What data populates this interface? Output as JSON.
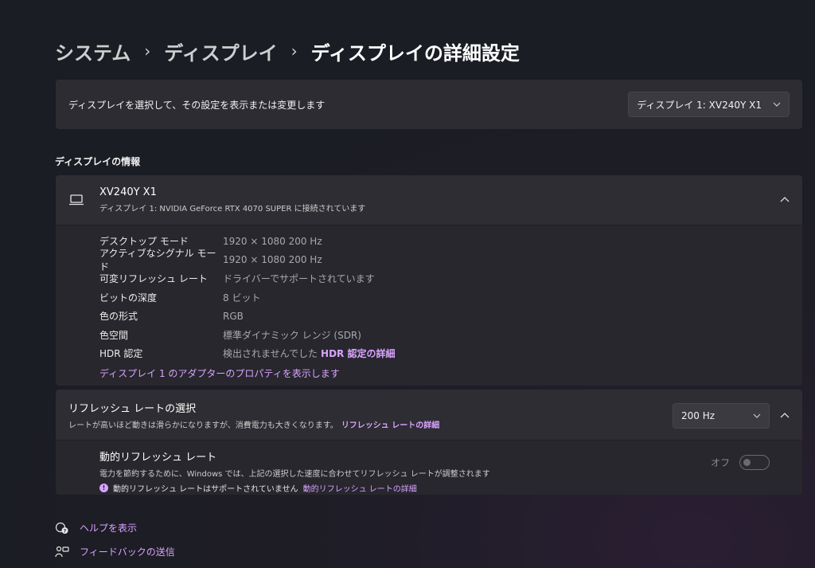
{
  "breadcrumb": {
    "items": [
      "システム",
      "ディスプレイ"
    ],
    "separator": "›",
    "current": "ディスプレイの詳細設定"
  },
  "display_select": {
    "label": "ディスプレイを選択して、その設定を表示または変更します",
    "selected": "ディスプレイ 1: XV240Y X1"
  },
  "display_info": {
    "section_title": "ディスプレイの情報",
    "name": "XV240Y X1",
    "subtitle": "ディスプレイ 1: NVIDIA GeForce RTX 4070 SUPER に接続されています",
    "rows": [
      {
        "key": "デスクトップ モード",
        "value": "1920 × 1080 200 Hz"
      },
      {
        "key": "アクティブなシグナル モード",
        "value": "1920 × 1080 200 Hz"
      },
      {
        "key": "可変リフレッシュ レート",
        "value": "ドライバーでサポートされています"
      },
      {
        "key": "ビットの深度",
        "value": "8 ビット"
      },
      {
        "key": "色の形式",
        "value": "RGB"
      },
      {
        "key": "色空間",
        "value": "標準ダイナミック レンジ (SDR)"
      },
      {
        "key": "HDR 認定",
        "value": "検出されませんでした",
        "link": "HDR 認定の詳細"
      }
    ],
    "adapter_link": "ディスプレイ 1 のアダプターのプロパティを表示します"
  },
  "refresh": {
    "title": "リフレッシュ レートの選択",
    "desc": "レートが高いほど動きは滑らかになりますが、消費電力も大きくなります。",
    "desc_link": "リフレッシュ レートの詳細",
    "selected": "200 Hz"
  },
  "dynamic": {
    "title": "動的リフレッシュ レート",
    "desc": "電力を節約するために、Windows では、上記の選択した速度に合わせてリフレッシュ レートが調整されます",
    "notice": "動的リフレッシュ レートはサポートされていません",
    "notice_link": "動的リフレッシュ レートの詳細",
    "toggle_label": "オフ",
    "toggle_on": false
  },
  "footer": {
    "help": "ヘルプを表示",
    "feedback": "フィードバックの送信"
  },
  "colors": {
    "accent": "#d9a3ff",
    "card": "#2c2c32",
    "background": "#1f1d27"
  }
}
